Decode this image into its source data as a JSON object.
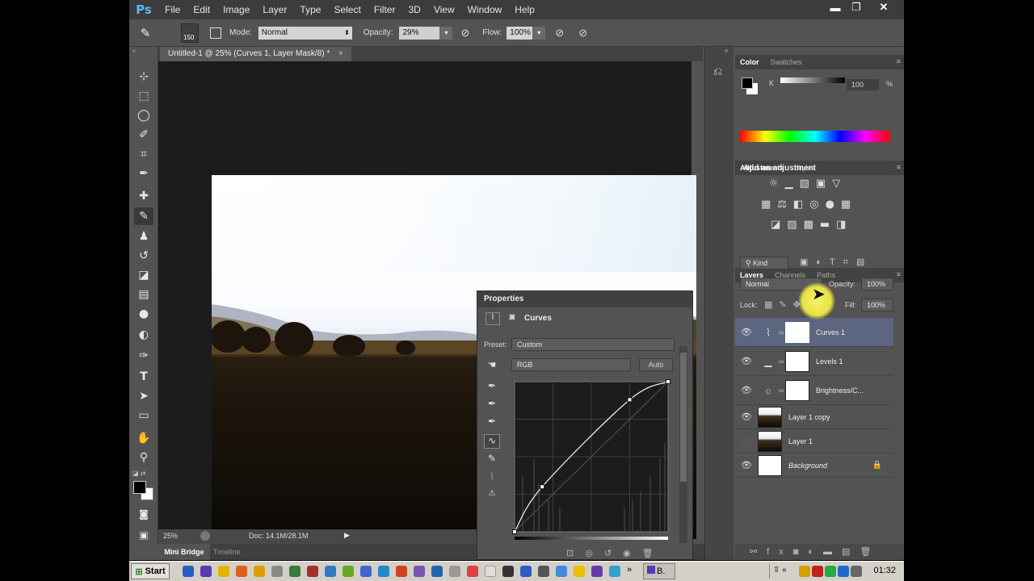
{
  "menubar": {
    "logo": "Ps",
    "menus": [
      "File",
      "Edit",
      "Image",
      "Layer",
      "Type",
      "Select",
      "Filter",
      "3D",
      "View",
      "Window",
      "Help"
    ],
    "window_controls": [
      "minimize",
      "restore",
      "close"
    ]
  },
  "options": {
    "brush_size": "150",
    "mode_label": "Mode:",
    "mode_value": "Normal",
    "opacity_label": "Opacity:",
    "opacity_value": "29%",
    "flow_label": "Flow:",
    "flow_value": "100%"
  },
  "document": {
    "tab_title": "Untitled-1 @ 25% (Curves 1, Layer Mask/8) *",
    "close_glyph": "×"
  },
  "toolbar": {
    "tools": [
      "move-icon",
      "marquee-icon",
      "lasso-icon",
      "quick-select-icon",
      "crop-icon",
      "eyedropper-icon",
      "healing-icon",
      "brush-icon",
      "stamp-icon",
      "history-brush-icon",
      "eraser-icon",
      "gradient-icon",
      "blur-icon",
      "dodge-icon",
      "pen-icon",
      "type-icon",
      "path-select-icon",
      "rectangle-icon",
      "hand-icon",
      "zoom-icon"
    ]
  },
  "status": {
    "zoom": "25%",
    "doc_info": "Doc: 14.1M/28.1M"
  },
  "bottom_tabs": [
    "Mini Bridge",
    "Timeline"
  ],
  "color_panel": {
    "tabs": [
      "Color",
      "Swatches"
    ],
    "channel_label": "K",
    "value": "100",
    "unit": "%",
    "fg_color": "#000000",
    "bg_color": "#ffffff"
  },
  "adjustments_panel": {
    "tabs": [
      "Adjustments",
      "Styles"
    ],
    "heading": "Add an adjustment"
  },
  "layers_panel": {
    "tabs": [
      "Layers",
      "Channels",
      "Paths"
    ],
    "filter_kind": "Kind",
    "blend_mode": "Normal",
    "opacity_label": "Opacity:",
    "opacity_value": "100%",
    "lock_label": "Lock:",
    "fill_label": "Fill:",
    "fill_value": "100%",
    "layers": [
      {
        "name": "Curves 1",
        "selected": true,
        "type": "curves"
      },
      {
        "name": "Levels 1",
        "selected": false,
        "type": "levels"
      },
      {
        "name": "Brightness/C...",
        "selected": false,
        "type": "brightness"
      },
      {
        "name": "Layer 1 copy",
        "selected": false,
        "type": "photo"
      },
      {
        "name": "Layer 1",
        "selected": false,
        "type": "photo",
        "hidden": true
      },
      {
        "name": "Background",
        "selected": false,
        "type": "white",
        "locked": true
      }
    ]
  },
  "properties_panel": {
    "title": "Properties",
    "adjustment_name": "Curves",
    "preset_label": "Preset:",
    "preset_value": "Custom",
    "channel_value": "RGB",
    "auto_label": "Auto"
  },
  "curve": {
    "points": [
      [
        0,
        0
      ],
      [
        18,
        30
      ],
      [
        75,
        88
      ],
      [
        100,
        100
      ]
    ]
  },
  "taskbar": {
    "start_label": "Start",
    "task_label": "B.",
    "clock": "01:32"
  }
}
